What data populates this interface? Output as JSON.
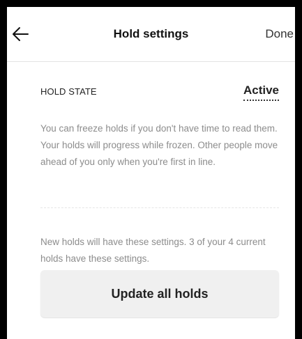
{
  "header": {
    "back_icon": "arrow-left-icon",
    "title": "Hold settings",
    "done_label": "Done"
  },
  "hold_state": {
    "label": "HOLD STATE",
    "value": "Active",
    "description": "You can freeze holds if you don't have time to read them. Your holds will progress while frozen. Other people move ahead of you only when you're first in line."
  },
  "apply": {
    "description": "New holds will have these settings. 3 of your 4 current holds have these settings.",
    "update_label": "Update all holds"
  }
}
